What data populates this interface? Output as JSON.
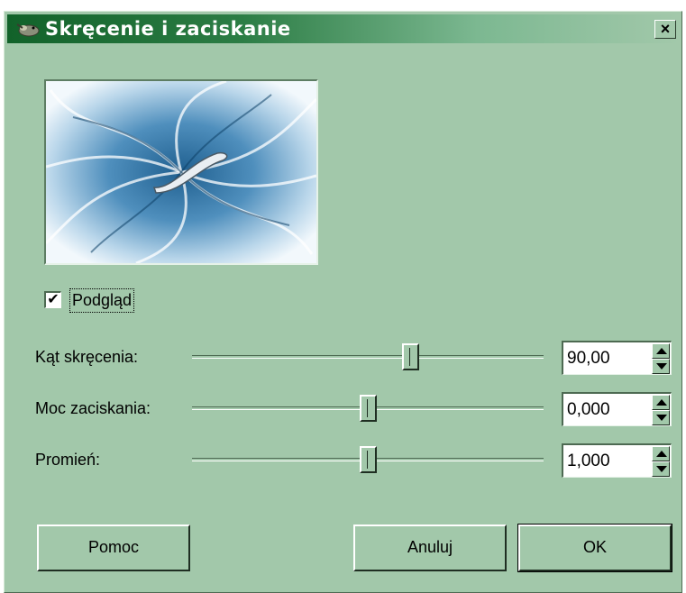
{
  "window": {
    "title": "Skręcenie i zaciskanie",
    "close_label": "×"
  },
  "preview": {
    "checkbox_label": "Podgląd",
    "checked": true,
    "checkmark": "✔"
  },
  "params": [
    {
      "label": "Kąt skręcenia:",
      "value": "90,00",
      "slider_fraction": 0.62
    },
    {
      "label": "Moc zaciskania:",
      "value": "0,000",
      "slider_fraction": 0.5
    },
    {
      "label": "Promień:",
      "value": "1,000",
      "slider_fraction": 0.5
    }
  ],
  "buttons": {
    "help": "Pomoc",
    "cancel": "Anuluj",
    "ok": "OK"
  },
  "colors": {
    "background": "#a2c8aa",
    "title_start": "#12622a",
    "preview_blue": "#2f6f9b"
  }
}
